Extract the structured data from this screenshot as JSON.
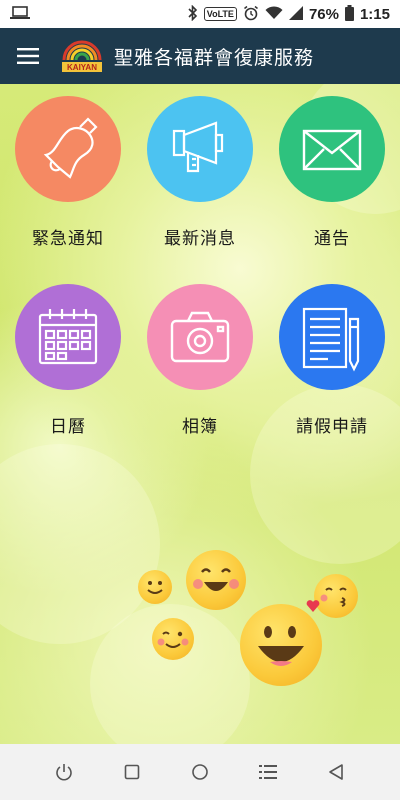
{
  "status_bar": {
    "volte": "VoLTE",
    "battery": "76%",
    "time": "1:15"
  },
  "app_bar": {
    "title": "聖雅各福群會復康服務",
    "logo_text": "KAIYAN"
  },
  "tiles": [
    {
      "label": "緊急通知",
      "icon": "bell-icon",
      "color": "#f58963"
    },
    {
      "label": "最新消息",
      "icon": "megaphone-icon",
      "color": "#4cc3f1"
    },
    {
      "label": "通告",
      "icon": "envelope-icon",
      "color": "#2ec27e"
    },
    {
      "label": "日曆",
      "icon": "calendar-icon",
      "color": "#b06fd6"
    },
    {
      "label": "相簿",
      "icon": "camera-icon",
      "color": "#f58fb5"
    },
    {
      "label": "請假申請",
      "icon": "document-pen-icon",
      "color": "#2b78f0"
    }
  ],
  "nav_bar": {
    "icons": [
      "power-icon",
      "square-icon",
      "circle-icon",
      "list-icon",
      "back-triangle-icon"
    ]
  }
}
